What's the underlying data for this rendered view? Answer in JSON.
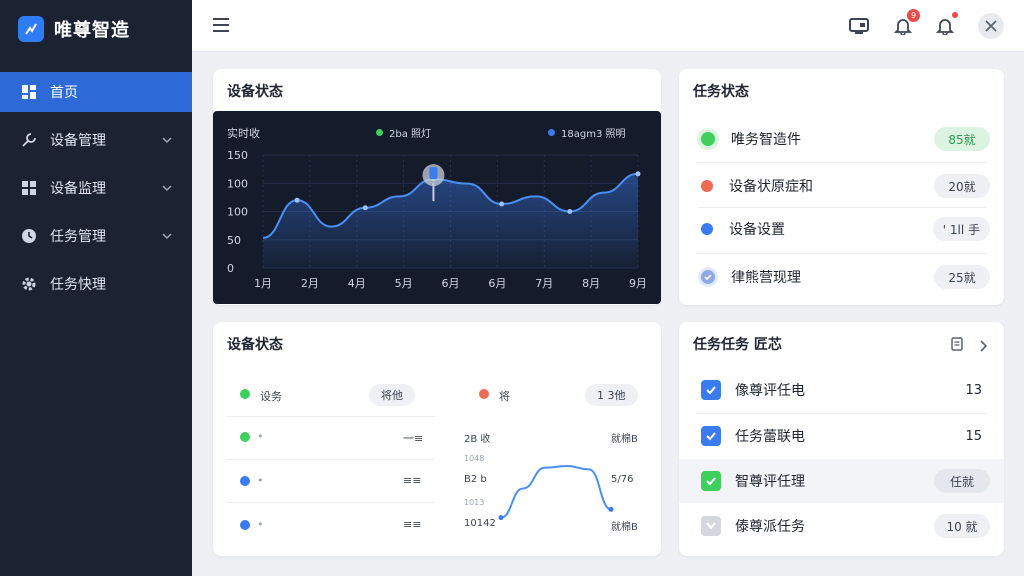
{
  "brand": {
    "name": "唯尊智造",
    "logo_icon": "chart-logo-icon"
  },
  "sidebar": {
    "items": [
      {
        "label": "首页",
        "icon": "dashboard-grid-icon",
        "active": true,
        "has_chevron": false
      },
      {
        "label": "设备管理",
        "icon": "wrench-icon",
        "active": false,
        "has_chevron": true
      },
      {
        "label": "设备监理",
        "icon": "grid-icon",
        "active": false,
        "has_chevron": true
      },
      {
        "label": "任务管理",
        "icon": "clock-icon",
        "active": false,
        "has_chevron": true
      },
      {
        "label": "任务快理",
        "icon": "gear-icon",
        "active": false,
        "has_chevron": false
      }
    ]
  },
  "topbar": {
    "notification_badge": "9",
    "icons": [
      "menu-icon",
      "monitor-icon",
      "bell-icon",
      "alert-bell-icon",
      "close-icon"
    ]
  },
  "device_chart_card": {
    "title": "设备状态",
    "chart_header": "实时收",
    "legend": [
      {
        "label": "2ba 照灯",
        "color": "#3ecf5d"
      },
      {
        "label": "18agm3 照明",
        "color": "#3a7bf0"
      }
    ],
    "chart_data": {
      "type": "area",
      "categories": [
        "1月",
        "2月",
        "4月",
        "5月",
        "6月",
        "6月",
        "7月",
        "8月",
        "9月"
      ],
      "yticks": [
        "150",
        "100",
        "100",
        "50",
        "0"
      ],
      "ylim": [
        0,
        150
      ],
      "grid": true,
      "series": [
        {
          "values": [
            40,
            90,
            55,
            80,
            95,
            118,
            112,
            85,
            95,
            75,
            100,
            125
          ]
        }
      ]
    }
  },
  "task_status_card": {
    "title": "任务状态",
    "rows": [
      {
        "label": "唯务智造件",
        "dot_color": "#3ecf5d",
        "value": "85就",
        "pill_style": "green"
      },
      {
        "label": "设备状原症和",
        "dot_color": "#ef6a55",
        "value": "20就",
        "pill_style": "gray"
      },
      {
        "label": "设备设置",
        "dot_color": "#3a7bf0",
        "value": "' 1ll 手",
        "pill_style": "gray"
      },
      {
        "label": "律熊营现理",
        "dot_color": "#8ea9e8",
        "value": "25就",
        "pill_style": "gray"
      }
    ]
  },
  "device_status_card": {
    "title": "设备状态",
    "header_left": {
      "label": "设务",
      "pill": "将他",
      "color": "#3ecf5d"
    },
    "header_right": {
      "label": "将",
      "pill": "1 3他",
      "color": "#ef6a55"
    },
    "left_rows": [
      {
        "color": "#3ecf5d",
        "label": "•",
        "value": "一≡"
      },
      {
        "color": "#3a7bf0",
        "label": "•",
        "value": "≡≡"
      },
      {
        "color": "#3a7bf0",
        "label": "•",
        "value": "≡≡"
      }
    ],
    "mini_chart": {
      "y_labels": [
        "2B 收",
        "1048",
        "B2 b",
        "1013",
        "10142"
      ],
      "right_labels": [
        "就棉B",
        "5/76",
        "就棉B"
      ],
      "values": [
        10,
        45,
        70,
        72,
        68,
        20
      ]
    }
  },
  "task_list_card": {
    "title": "任务任务 匠芯",
    "rows": [
      {
        "label": "像尊评任电",
        "check_color": "#3a7bf0",
        "value": "13",
        "style": "num"
      },
      {
        "label": "任务蕾联电",
        "check_color": "#3a7bf0",
        "value": "15",
        "style": "num"
      },
      {
        "label": "智尊评任理",
        "check_color": "#3ecf5d",
        "value": "任就",
        "style": "pill"
      },
      {
        "label": "傣尊派任务",
        "check_color": "#d4d7de",
        "value": "10 就",
        "style": "pill"
      }
    ]
  }
}
